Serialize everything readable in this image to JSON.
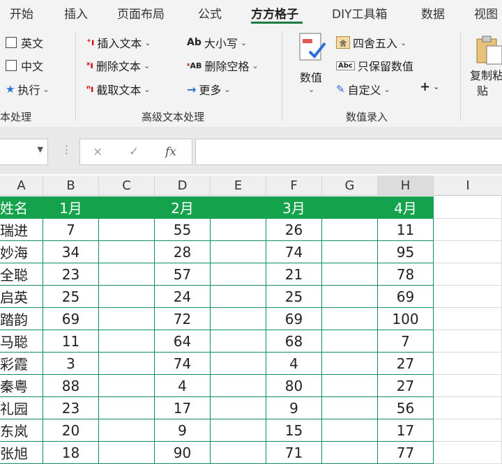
{
  "ribbon_tabs": [
    {
      "label": "开始",
      "active": false
    },
    {
      "label": "插入",
      "active": false
    },
    {
      "label": "页面布局",
      "active": false
    },
    {
      "label": "公式",
      "active": false
    },
    {
      "label": "方方格子",
      "active": true
    },
    {
      "label": "DIY工具箱",
      "active": false
    },
    {
      "label": "数据",
      "active": false
    },
    {
      "label": "视图",
      "active": false
    }
  ],
  "ribbon": {
    "text_group": {
      "english": "英文",
      "chinese": "中文",
      "execute": "执行",
      "label": "本处理"
    },
    "advanced_text": {
      "insert_text": "插入文本",
      "delete_text": "删除文本",
      "extract_text": "截取文本",
      "case": "大小写",
      "delete_spaces": "删除空格",
      "more": "更多",
      "label": "高级文本处理"
    },
    "numeric_entry": {
      "numeric": "数值",
      "round": "四舍五入",
      "keep_numeric": "只保留数值",
      "custom": "自定义",
      "plus": "+",
      "label": "数值录入"
    },
    "paste_group": {
      "copy_paste_line1": "复制粘",
      "copy_paste_line2": "贴"
    }
  },
  "formula_bar": {
    "cancel": "×",
    "confirm": "✓",
    "fx": "fx",
    "formula": ""
  },
  "columns": [
    "A",
    "B",
    "C",
    "D",
    "E",
    "F",
    "G",
    "H",
    "I"
  ],
  "selected_column": "H",
  "header_row": {
    "A": "姓名",
    "B": "1月",
    "C": "",
    "D": "2月",
    "E": "",
    "F": "3月",
    "G": "",
    "H": "4月"
  },
  "rows": [
    {
      "name": "瑞进",
      "m1": "7",
      "m2": "55",
      "m3": "26",
      "m4": "11"
    },
    {
      "name": "妙海",
      "m1": "34",
      "m2": "28",
      "m3": "74",
      "m4": "95"
    },
    {
      "name": "全聪",
      "m1": "23",
      "m2": "57",
      "m3": "21",
      "m4": "78"
    },
    {
      "name": "启英",
      "m1": "25",
      "m2": "24",
      "m3": "25",
      "m4": "69"
    },
    {
      "name": "踏韵",
      "m1": "69",
      "m2": "72",
      "m3": "69",
      "m4": "100"
    },
    {
      "name": "马聪",
      "m1": "11",
      "m2": "64",
      "m3": "68",
      "m4": "7"
    },
    {
      "name": "彩霞",
      "m1": "3",
      "m2": "74",
      "m3": "4",
      "m4": "27"
    },
    {
      "name": "秦粤",
      "m1": "88",
      "m2": "4",
      "m3": "80",
      "m4": "27"
    },
    {
      "name": "礼园",
      "m1": "23",
      "m2": "17",
      "m3": "9",
      "m4": "56"
    },
    {
      "name": "东岚",
      "m1": "20",
      "m2": "9",
      "m3": "15",
      "m4": "17"
    },
    {
      "name": "张旭",
      "m1": "18",
      "m2": "90",
      "m3": "71",
      "m4": "77"
    }
  ],
  "colors": {
    "accent": "#1d7a45",
    "header_fill": "#14a34c",
    "grid_line": "#0f8d6e"
  }
}
